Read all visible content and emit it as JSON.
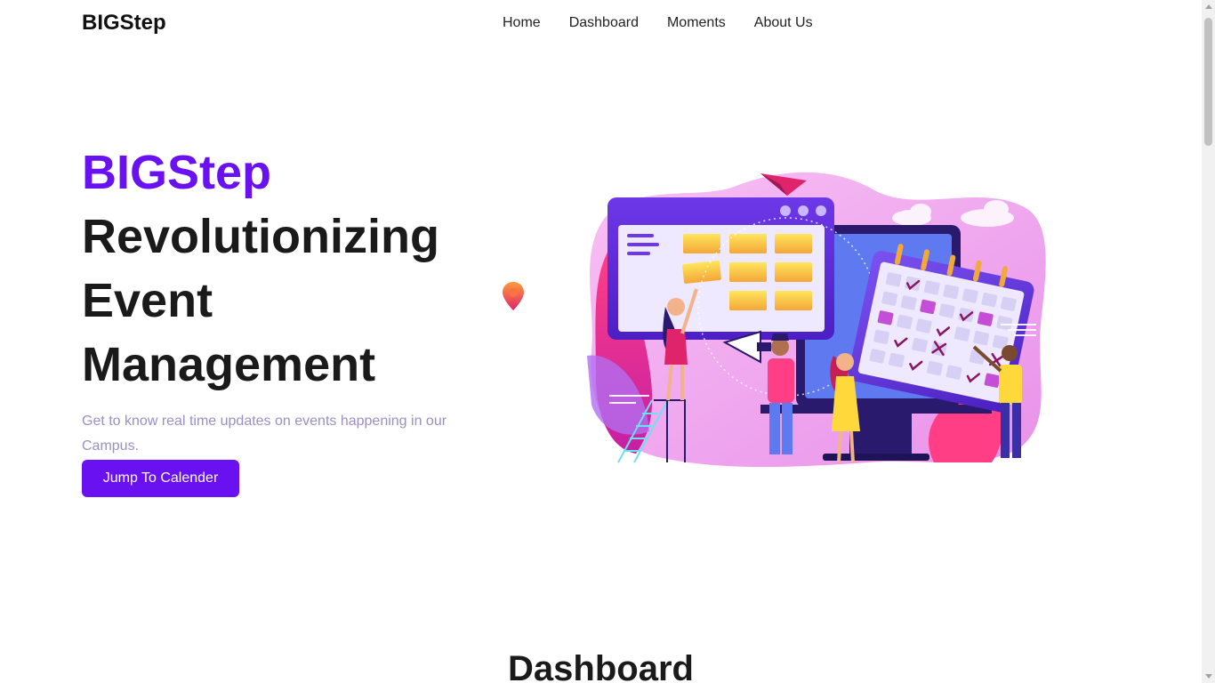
{
  "brand": "BIGStep",
  "nav": {
    "items": [
      "Home",
      "Dashboard",
      "Moments",
      "About Us"
    ]
  },
  "hero": {
    "accent": "BIGStep",
    "title_lines": [
      "Revolutionizing",
      "Event",
      "Management"
    ],
    "subtitle": "Get to know real time updates on events happening in our Campus.",
    "cta_label": "Jump To Calender"
  },
  "illustration": {
    "icon": "event-calendar-illustration"
  },
  "sections": {
    "dashboard_title": "Dashboard"
  },
  "colors": {
    "accent": "#6a11f2",
    "subtitle": "#9b8fc7",
    "text": "#1a1a1a"
  }
}
